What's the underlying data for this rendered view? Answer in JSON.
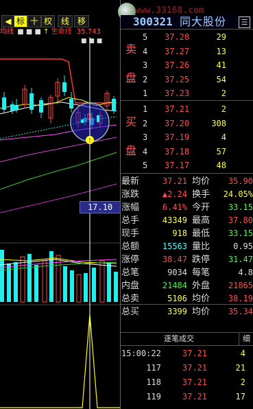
{
  "toolbar": {
    "buttons": [
      "标",
      "十",
      "权",
      "线",
      "移"
    ],
    "scroll_left": "◀",
    "subtitle_a": "均线",
    "subtitle_b": "↑",
    "subtitle_c": "生命线",
    "subtitle_value": "35.743"
  },
  "header": {
    "code": "300321",
    "name": "同大股份",
    "logo_text": "www.33168.com",
    "menu_icon": "☰"
  },
  "order_book": {
    "sell_label_1": "卖",
    "sell_label_2": "盘",
    "buy_label_1": "买",
    "buy_label_2": "盘",
    "sell": [
      {
        "level": "5",
        "price": "37.28",
        "vol": "29"
      },
      {
        "level": "4",
        "price": "37.27",
        "vol": "13"
      },
      {
        "level": "3",
        "price": "37.26",
        "vol": "41"
      },
      {
        "level": "2",
        "price": "37.25",
        "vol": "54"
      },
      {
        "level": "1",
        "price": "37.23",
        "vol": "2"
      }
    ],
    "buy": [
      {
        "level": "1",
        "price": "37.21",
        "vol": "2"
      },
      {
        "level": "2",
        "price": "37.20",
        "vol": "308"
      },
      {
        "level": "3",
        "price": "37.19",
        "vol": "4"
      },
      {
        "level": "4",
        "price": "37.18",
        "vol": "57"
      },
      {
        "level": "5",
        "price": "37.17",
        "vol": "48"
      }
    ]
  },
  "stats_left": [
    {
      "label": "最新",
      "value": "37.21",
      "color": "red"
    },
    {
      "label": "涨跌",
      "value": "▲2.24",
      "color": "red"
    },
    {
      "label": "涨幅",
      "value": "6.41%",
      "color": "red"
    },
    {
      "label": "总手",
      "value": "43349",
      "color": "yellow"
    },
    {
      "label": "现手",
      "value": "918",
      "color": "yellow"
    },
    {
      "label": "总额",
      "value": "15563",
      "color": "cyan"
    },
    {
      "label": "涨停",
      "value": "38.47",
      "color": "red"
    },
    {
      "label": "总笔",
      "value": "9034",
      "color": "white"
    },
    {
      "label": "内盘",
      "value": "21484",
      "color": "green"
    },
    {
      "label": "总卖",
      "value": "5106",
      "color": "yellow"
    },
    {
      "label": "总买",
      "value": "3399",
      "color": "yellow"
    }
  ],
  "stats_right": [
    {
      "label": "均价",
      "value": "35.90",
      "color": "red"
    },
    {
      "label": "换手",
      "value": "24.05%",
      "color": "yellow"
    },
    {
      "label": "今开",
      "value": "33.15",
      "color": "green"
    },
    {
      "label": "最高",
      "value": "37.80",
      "color": "red"
    },
    {
      "label": "最低",
      "value": "33.15",
      "color": "green"
    },
    {
      "label": "量比",
      "value": "0.95",
      "color": "white"
    },
    {
      "label": "跌停",
      "value": "31.47",
      "color": "green"
    },
    {
      "label": "每笔",
      "value": "4.8",
      "color": "white"
    },
    {
      "label": "外盘",
      "value": "21865",
      "color": "red"
    },
    {
      "label": "均价",
      "value": "38.19",
      "color": "red"
    },
    {
      "label": "均价",
      "value": "35.34",
      "color": "red"
    }
  ],
  "trades_header": {
    "title": "逐笔成交",
    "detail": "细"
  },
  "trades": [
    {
      "time": "15:00:22",
      "price": "37.21",
      "vol": "4"
    },
    {
      "time": "117",
      "price": "37.21",
      "vol": "21"
    },
    {
      "time": "118",
      "price": "37.21",
      "vol": "2"
    },
    {
      "time": "119",
      "price": "37.21",
      "vol": "17"
    }
  ],
  "chart": {
    "cursor_price": "17.10",
    "warning_icon": "!",
    "dots_a": "■ ■ ■",
    "dots_b": "■ ■ ■"
  },
  "colors": {
    "up": "#ff4a4a",
    "down": "#00e5ff",
    "ma_white": "#ffffff",
    "ma_yellow": "#ffff00",
    "ma_pink": "#ff4dff",
    "ma_green": "#33cc33"
  }
}
